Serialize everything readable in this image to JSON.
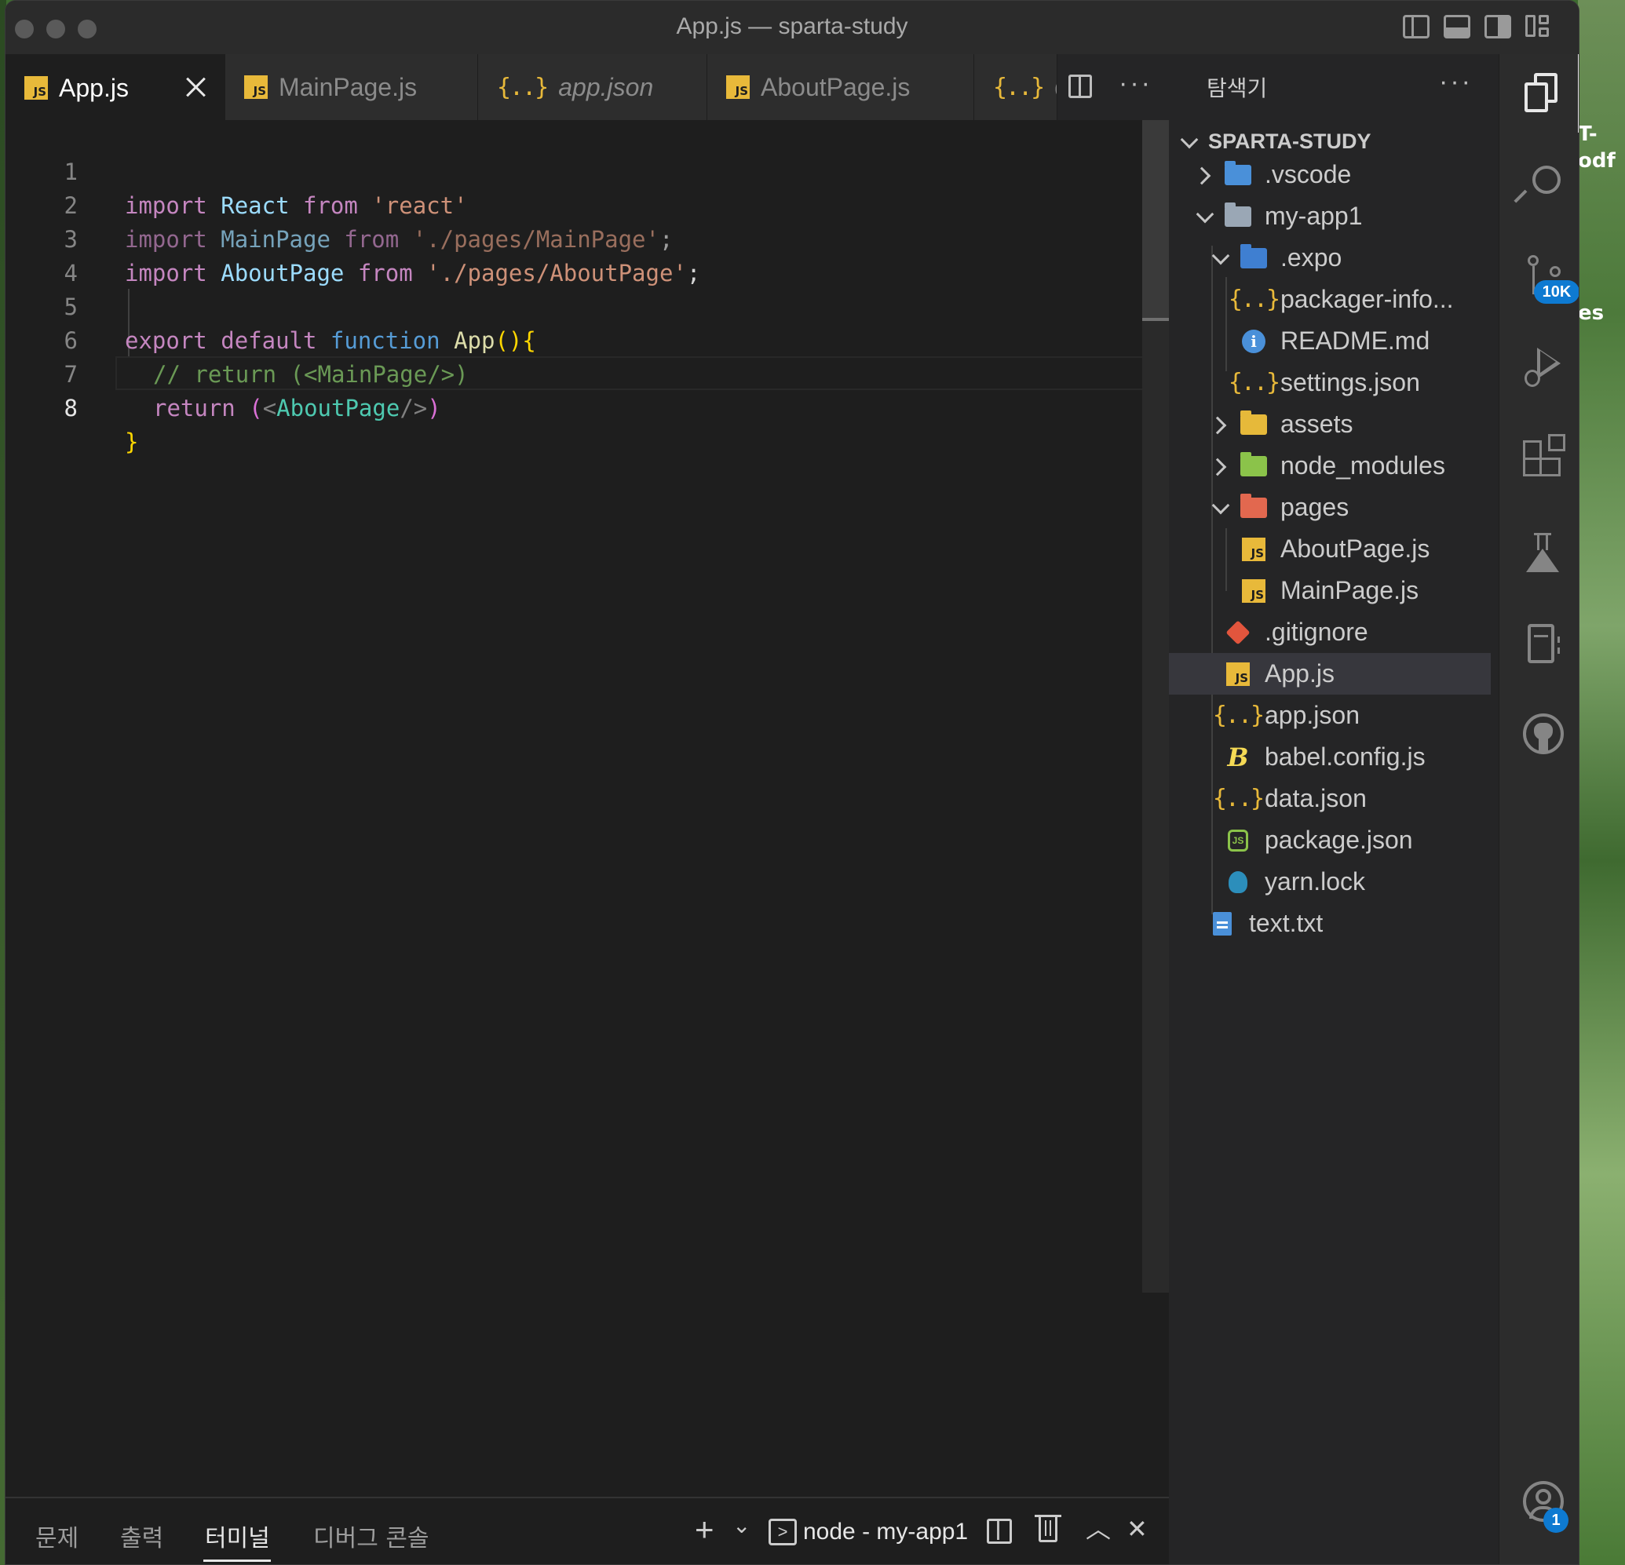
{
  "window": {
    "title": "App.js — sparta-study"
  },
  "desktop": {
    "labels": [
      "T-",
      "odf",
      "es"
    ]
  },
  "tabs": [
    {
      "label": "App.js",
      "icon": "js-icon",
      "active": true
    },
    {
      "label": "MainPage.js",
      "icon": "js-icon"
    },
    {
      "label": "app.json",
      "icon": "json-icon",
      "italic": true
    },
    {
      "label": "AboutPage.js",
      "icon": "js-icon"
    },
    {
      "label": "da",
      "icon": "json-icon"
    }
  ],
  "editor": {
    "lines": [
      {
        "n": "1",
        "tokens": [
          [
            "kw",
            "import"
          ],
          [
            "",
            ""
          ],
          [
            "id",
            " React"
          ],
          [
            "kw",
            " from"
          ],
          [
            "str",
            " 'react'"
          ]
        ]
      },
      {
        "n": "2"
      },
      {
        "n": "3"
      },
      {
        "n": "4"
      },
      {
        "n": "5"
      },
      {
        "n": "6"
      },
      {
        "n": "7"
      },
      {
        "n": "8"
      }
    ],
    "code": {
      "l1": {
        "import": "import",
        "name": "React",
        "from": "from",
        "src": "'react'"
      },
      "l2": {
        "import": "import",
        "name": "MainPage",
        "from": "from",
        "src": "'./pages/MainPage'",
        "semi": ";"
      },
      "l3": {
        "import": "import",
        "name": "AboutPage",
        "from": "from",
        "src": "'./pages/AboutPage'",
        "semi": ";"
      },
      "l5": {
        "export": "export",
        "default": "default",
        "function": "function",
        "name": "App",
        "parens": "()",
        "brace": "{"
      },
      "l6": {
        "comment": "// return (<MainPage/>)"
      },
      "l7": {
        "return": "return",
        "open": "(",
        "lt": "<",
        "tag": "AboutPage",
        "close_tag": "/>",
        "close": ")"
      },
      "l8": {
        "brace": "}"
      }
    }
  },
  "panel": {
    "tabs": [
      "문제",
      "출력",
      "터미널",
      "디버그 콘솔"
    ],
    "active_tab": "터미널",
    "terminal_name": "node - my-app1",
    "add_glyph": "+",
    "chevron_glyph": "⌄",
    "maximize_glyph": "︿",
    "close_glyph": "✕",
    "prompt_glyph": ">"
  },
  "explorer": {
    "title": "탐색기",
    "more": "···",
    "root": "SPARTA-STUDY",
    "items": [
      {
        "label": ".vscode",
        "type": "folder",
        "depth": 1,
        "state": "collapsed",
        "color": "#4a90d9"
      },
      {
        "label": "my-app1",
        "type": "folder",
        "depth": 1,
        "state": "expanded",
        "color": "#9aa7b5"
      },
      {
        "label": ".expo",
        "type": "folder",
        "depth": 2,
        "state": "expanded",
        "color": "#3f7fd1"
      },
      {
        "label": "packager-info...",
        "type": "json",
        "depth": 3
      },
      {
        "label": "README.md",
        "type": "info",
        "depth": 3
      },
      {
        "label": "settings.json",
        "type": "json",
        "depth": 3
      },
      {
        "label": "assets",
        "type": "folder",
        "depth": 2,
        "state": "collapsed",
        "color": "#e6b93a"
      },
      {
        "label": "node_modules",
        "type": "folder",
        "depth": 2,
        "state": "collapsed",
        "color": "#8bc34a"
      },
      {
        "label": "pages",
        "type": "folder",
        "depth": 2,
        "state": "expanded",
        "color": "#e2684f"
      },
      {
        "label": "AboutPage.js",
        "type": "js",
        "depth": 3
      },
      {
        "label": "MainPage.js",
        "type": "js",
        "depth": 3
      },
      {
        "label": ".gitignore",
        "type": "git",
        "depth": 2
      },
      {
        "label": "App.js",
        "type": "js",
        "depth": 2,
        "selected": true
      },
      {
        "label": "app.json",
        "type": "json",
        "depth": 2
      },
      {
        "label": "babel.config.js",
        "type": "babel",
        "depth": 2
      },
      {
        "label": "data.json",
        "type": "json",
        "depth": 2
      },
      {
        "label": "package.json",
        "type": "node",
        "depth": 2
      },
      {
        "label": "yarn.lock",
        "type": "yarn",
        "depth": 2
      },
      {
        "label": "text.txt",
        "type": "txt",
        "depth": 1
      }
    ]
  },
  "activity": {
    "scm_badge": "10K",
    "accounts_badge": "1"
  },
  "colors": {
    "accent": "#0e7ad1",
    "js_yellow": "#e8b93a",
    "editor_bg": "#1e1e1e",
    "sidebar_bg": "#252526"
  }
}
